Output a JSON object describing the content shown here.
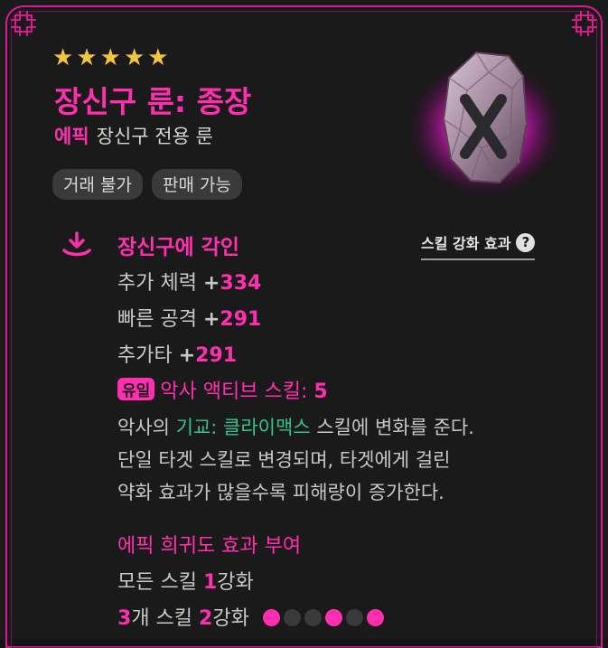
{
  "colors": {
    "accent": "#ff2fb0",
    "green": "#35c48d",
    "star": "#f3c53a",
    "background": "#1a1a1a"
  },
  "stars": {
    "count": 5
  },
  "item": {
    "name": "장신구 룬: 종장",
    "rarity": "에픽",
    "type": "장신구 전용 룬",
    "tags": [
      "거래 불가",
      "판매 가능"
    ]
  },
  "engrave": {
    "title": "장신구에 각인",
    "skill_effect_link": "스킬 강화 효과",
    "stats": [
      {
        "label": "추가 체력",
        "plus": "+",
        "value": "334"
      },
      {
        "label": "빠른 공격",
        "plus": "+",
        "value": "291"
      },
      {
        "label": "추가타",
        "plus": "+",
        "value": "291"
      }
    ],
    "unique": {
      "badge": "유일",
      "text": "악사 액티브 스킬:",
      "value": "5"
    },
    "description": {
      "p1": "악사의 ",
      "skill": "기교: 클라이맥스",
      "p2": " 스킬에 변화를 준다.",
      "line2": "단일 타겟 스킬로 변경되며, 타겟에게 걸린",
      "line3": "약화 효과가 많을수록 피해량이 증가한다."
    }
  },
  "rarity_bonus": {
    "title": "에픽 희귀도 효과 부여",
    "line1": {
      "p1": "모든 스킬 ",
      "num": "1",
      "p2": "강화"
    },
    "line2": {
      "num1": "3",
      "p1": "개 스킬 ",
      "num2": "2",
      "p2": "강화"
    },
    "dots": [
      true,
      false,
      false,
      true,
      false,
      true
    ]
  },
  "icons": [
    "corner-knot-icon",
    "star-icon",
    "rune-stone-icon",
    "engrave-download-icon",
    "help-icon"
  ]
}
